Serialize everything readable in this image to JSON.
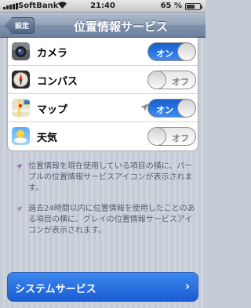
{
  "status_bar": {
    "carrier": "SoftBank",
    "time": "21:40",
    "battery_percent_label": "65 %",
    "battery_level": 0.65
  },
  "nav": {
    "back_label": "設定",
    "title": "位置情報サービス"
  },
  "apps": [
    {
      "name": "カメラ",
      "icon": "camera-icon",
      "state": "オン",
      "on": true,
      "arrow": false
    },
    {
      "name": "コンパス",
      "icon": "compass-icon",
      "state": "オフ",
      "on": false,
      "arrow": false
    },
    {
      "name": "マップ",
      "icon": "maps-icon",
      "state": "オン",
      "on": true,
      "arrow": true
    },
    {
      "name": "天気",
      "icon": "weather-icon",
      "state": "オフ",
      "on": false,
      "arrow": false
    }
  ],
  "notes": {
    "purple": "位置情報を現在使用している項目の横に、パープルの位置情報サービスアイコンが表示されます。",
    "gray": "過去24時間以内に位置情報を使用したことのある項目の横に、グレイの位置情報サービスアイコンが表示されます。"
  },
  "system_services": {
    "label": "システムサービス"
  },
  "colors": {
    "nav_bar": "#6d82a1",
    "toggle_on": "#1a5ccd",
    "purple_arrow": "#9b59c8",
    "gray_arrow": "#9a9a9a",
    "system_button": "#2f78e6"
  }
}
